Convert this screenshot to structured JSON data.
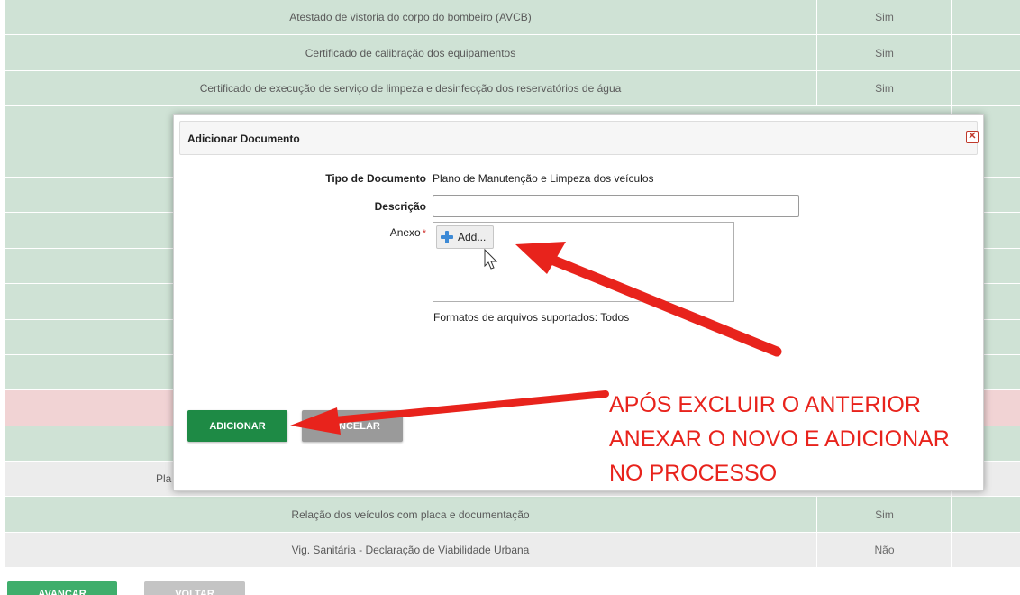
{
  "table": {
    "rows_before": [
      {
        "doc": "Atestado de vistoria do corpo do bombeiro (AVCB)",
        "val": "Sim"
      },
      {
        "doc": "Certificado de calibração dos equipamentos",
        "val": "Sim"
      },
      {
        "doc": "Certificado de execução de serviço de limpeza e desinfecção dos reservatórios de água",
        "val": "Sim"
      }
    ],
    "partial_row": "Pla",
    "rows_after": [
      {
        "doc": "Relação dos veículos com placa e documentação",
        "val": "Sim"
      },
      {
        "doc": "Vig. Sanitária - Declaração de Viabilidade Urbana",
        "val": "Não"
      }
    ]
  },
  "bottom_buttons": {
    "advance": "AVANÇAR",
    "back": "VOLTAR"
  },
  "modal": {
    "title": "Adicionar Documento",
    "close_symbol": "✕",
    "doc_type_label": "Tipo de Documento",
    "doc_type_value": "Plano de Manutenção e Limpeza dos veículos",
    "description_label": "Descrição",
    "description_value": "",
    "attachment_label": "Anexo",
    "required_mark": "*",
    "add_file_label": "Add...",
    "formats_text": "Formatos de arquivos suportados: Todos",
    "add_button": "ADICIONAR",
    "cancel_button": "CANCELAR"
  },
  "annotation": {
    "lines": [
      "APÓS EXCLUIR O ANTERIOR",
      "ANEXAR O NOVO E ADICIONAR",
      "NO PROCESSO"
    ],
    "color": "#e8231c"
  },
  "colors": {
    "row_green": "#cfe2d5",
    "row_gray": "#ececec",
    "row_red": "#f1d3d4",
    "button_green": "#1e8a45",
    "button_gray": "#9a9a9a"
  }
}
